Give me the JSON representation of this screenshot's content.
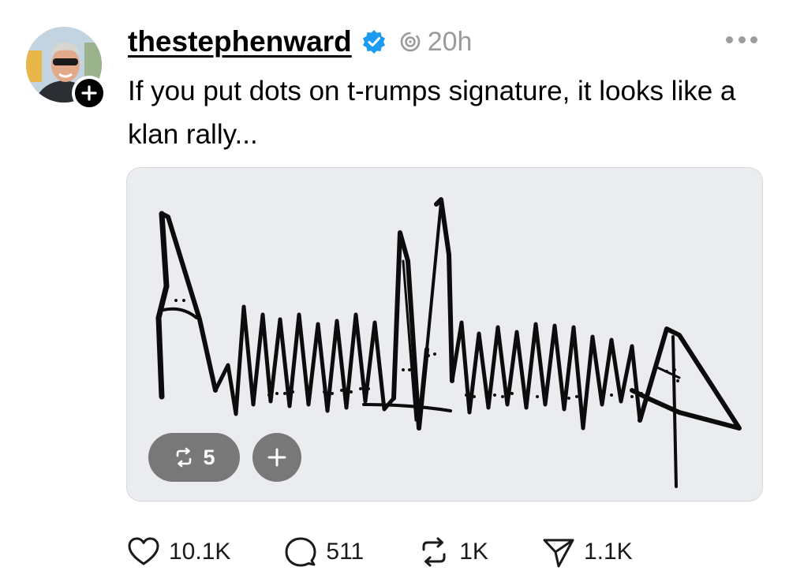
{
  "post": {
    "username": "thestephenward",
    "time": "20h",
    "text": "If you put dots on t-rumps signature, it looks like a klan rally..."
  },
  "media": {
    "repost_count": "5"
  },
  "actions": {
    "likes": "10.1K",
    "replies": "511",
    "reposts": "1K",
    "shares": "1.1K"
  },
  "colors": {
    "verified": "#1d9bf0",
    "muted": "#9a9a9a",
    "pill": "#6e6e6e"
  },
  "icons": [
    "verified-badge-icon",
    "thread-loop-icon",
    "more-icon",
    "plus-icon",
    "repost-icon",
    "heart-icon",
    "comment-icon",
    "send-icon"
  ]
}
